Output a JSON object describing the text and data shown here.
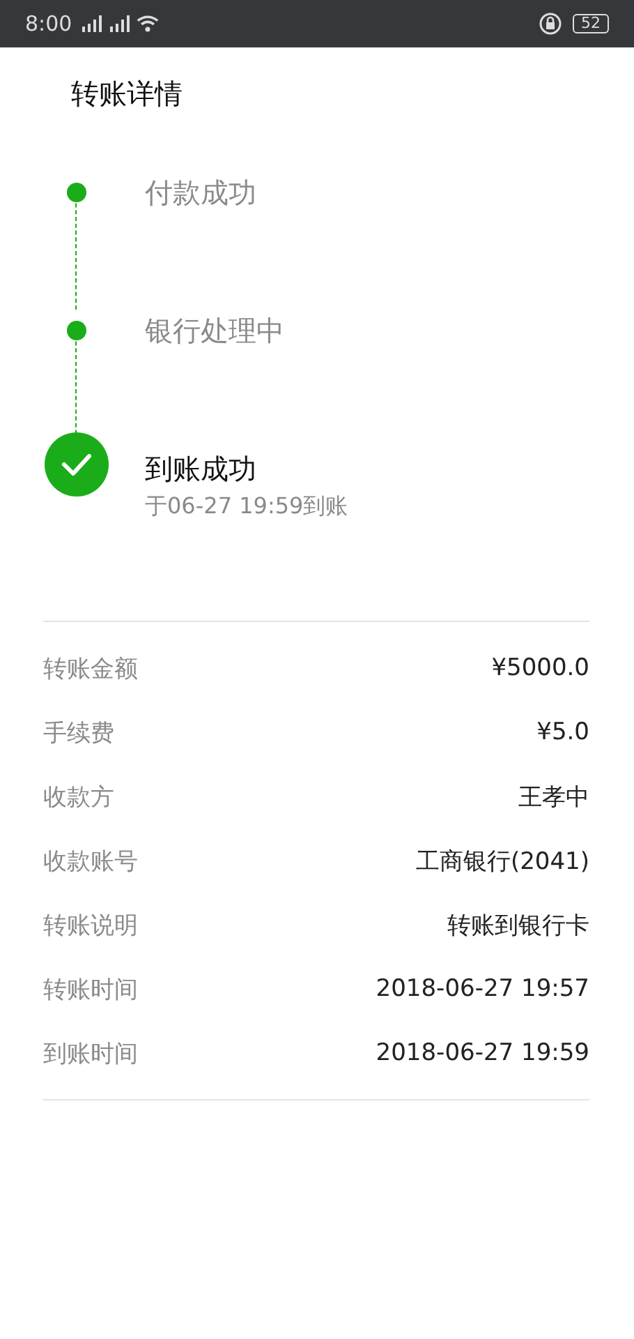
{
  "status_bar": {
    "time": "8:00",
    "battery": "52"
  },
  "title": "转账详情",
  "steps": [
    {
      "kind": "dot",
      "label": "付款成功"
    },
    {
      "kind": "dot",
      "label": "银行处理中"
    },
    {
      "kind": "check",
      "label": "到账成功",
      "detail": "于06-27 19:59到账"
    }
  ],
  "details": [
    {
      "label": "转账金额",
      "value": "¥5000.0"
    },
    {
      "label": "手续费",
      "value": "¥5.0"
    },
    {
      "label": "收款方",
      "value": "王孝中"
    },
    {
      "label": "收款账号",
      "value": "工商银行(2041)"
    },
    {
      "label": "转账说明",
      "value": "转账到银行卡"
    },
    {
      "label": "转账时间",
      "value": "2018-06-27 19:57"
    },
    {
      "label": "到账时间",
      "value": "2018-06-27 19:59"
    }
  ]
}
